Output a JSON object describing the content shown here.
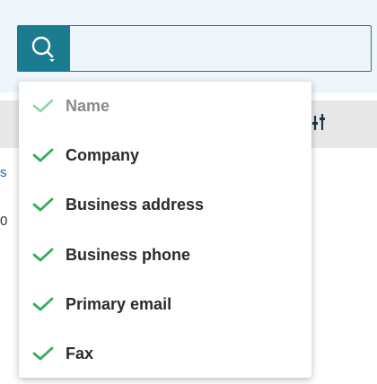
{
  "search": {
    "value": "",
    "placeholder": "",
    "button_icon": "search-icon"
  },
  "background_rows": [
    {
      "text": "s"
    },
    {
      "text": "0"
    }
  ],
  "column_options_icon": "column-filter-icon",
  "accent_color": "#1b7b8f",
  "check_color": "#2fae5a",
  "menu": {
    "items": [
      {
        "label": "Name",
        "checked": true,
        "disabled": true
      },
      {
        "label": "Company",
        "checked": true,
        "disabled": false
      },
      {
        "label": "Business address",
        "checked": true,
        "disabled": false
      },
      {
        "label": "Business phone",
        "checked": true,
        "disabled": false
      },
      {
        "label": "Primary email",
        "checked": true,
        "disabled": false
      },
      {
        "label": "Fax",
        "checked": true,
        "disabled": false
      }
    ]
  }
}
